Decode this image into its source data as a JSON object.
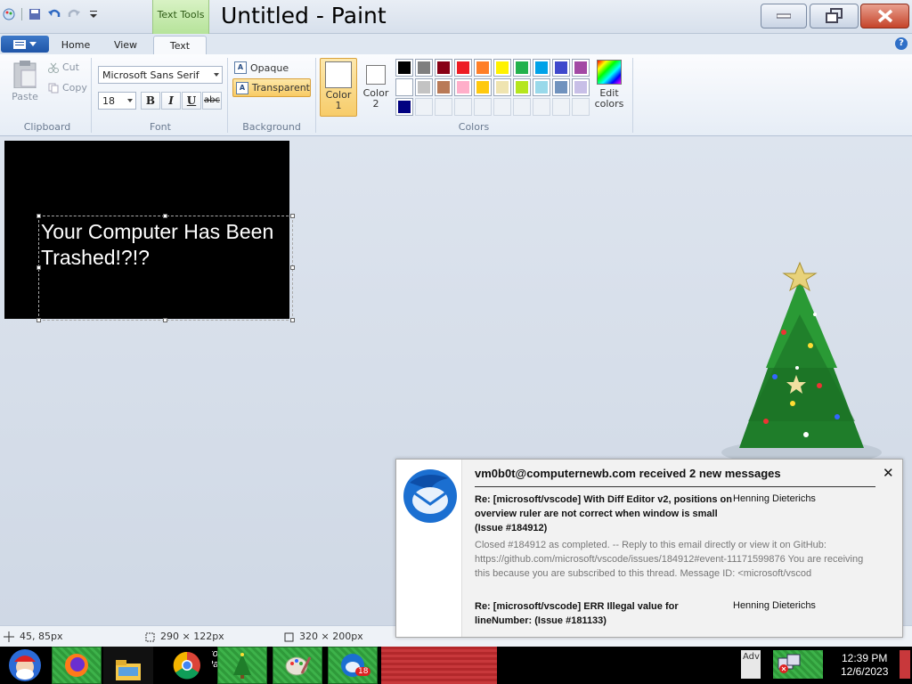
{
  "title_bar": {
    "title": "Untitled - Paint",
    "context_tab": "Text Tools"
  },
  "tabs": {
    "home": "Home",
    "view": "View",
    "text": "Text"
  },
  "clipboard": {
    "paste": "Paste",
    "cut": "Cut",
    "copy": "Copy",
    "group": "Clipboard"
  },
  "font": {
    "family": "Microsoft Sans Serif",
    "size": "18",
    "bold": "B",
    "italic": "I",
    "underline": "U",
    "strike": "abc",
    "group": "Font"
  },
  "background": {
    "opaque": "Opaque",
    "transparent": "Transparent",
    "group": "Background"
  },
  "colors": {
    "color1_line1": "Color",
    "color1_line2": "1",
    "color2_line1": "Color",
    "color2_line2": "2",
    "edit_line1": "Edit",
    "edit_line2": "colors",
    "group": "Colors",
    "palette": [
      "#000000",
      "#7f7f7f",
      "#880015",
      "#ed1c24",
      "#ff7f27",
      "#fff200",
      "#22b14c",
      "#00a2e8",
      "#3f48cc",
      "#a349a4",
      "#ffffff",
      "#c3c3c3",
      "#b97a57",
      "#ffaec9",
      "#ffc90e",
      "#efe4b0",
      "#b5e61d",
      "#99d9ea",
      "#7092be",
      "#c8bfe7",
      "#000080",
      "",
      "",
      "",
      "",
      "",
      "",
      "",
      "",
      ""
    ]
  },
  "canvas": {
    "text_line1": "Your Computer Has Been",
    "text_line2": "Trashed!?!?"
  },
  "status": {
    "cursor": "45, 85px",
    "selection": "290 × 122px",
    "size": "320 × 200px"
  },
  "notification": {
    "header": "vm0b0t@computernewb.com received 2 new messages",
    "messages": [
      {
        "subject": "Re: [microsoft/vscode] With Diff Editor v2, positions on overview ruler are not correct when window is small (Issue #184912)",
        "sender": "Henning Dieterichs",
        "body": "Closed #184912 as completed. -- Reply to this email directly or view it on GitHub: https://github.com/microsoft/vscode/issues/184912#event-11171599876 You are receiving this because you are subscribed to this thread. Message ID: <microsoft/vscod"
      },
      {
        "subject": "Re: [microsoft/vscode] ERR Illegal value for lineNumber: (Issue #181133)",
        "sender": "Henning Dieterichs",
        "body": ""
      }
    ]
  },
  "taskbar": {
    "ctrl_panel": "trol Panel",
    "adv": "Adv",
    "badge": "18",
    "time": "12:39 PM",
    "date": "12/6/2023"
  }
}
